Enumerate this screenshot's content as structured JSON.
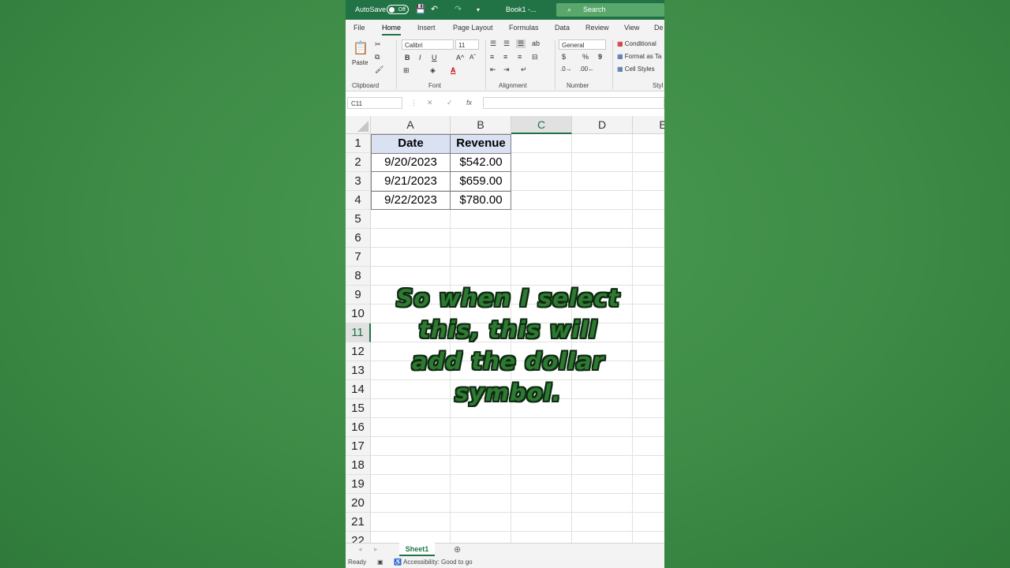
{
  "titlebar": {
    "autosave_label": "AutoSave",
    "autosave_state": "Off",
    "book_title": "Book1 -...",
    "search_placeholder": "Search"
  },
  "ribbon": {
    "tabs": [
      "File",
      "Home",
      "Insert",
      "Page Layout",
      "Formulas",
      "Data",
      "Review",
      "View",
      "De"
    ],
    "active_tab": "Home",
    "clipboard": {
      "paste_label": "Paste",
      "group_label": "Clipboard"
    },
    "font": {
      "font_name": "Calibri",
      "font_size": "11",
      "bold": "B",
      "italic": "I",
      "underline": "U",
      "grow": "A^",
      "shrink": "Aˇ",
      "group_label": "Font"
    },
    "alignment": {
      "group_label": "Alignment"
    },
    "number": {
      "format": "General",
      "currency": "$",
      "percent": "%",
      "comma": "9",
      "group_label": "Number"
    },
    "styles": {
      "conditional": "Conditional",
      "format_as_table": "Format as Ta",
      "cell_styles": "Cell Styles",
      "group_label": "Styl"
    }
  },
  "formula_bar": {
    "name_box": "C11",
    "fx": "fx",
    "value": ""
  },
  "columns": [
    "A",
    "B",
    "C",
    "D",
    "E"
  ],
  "selected_column": "C",
  "rows": [
    "1",
    "2",
    "3",
    "4",
    "5",
    "6",
    "7",
    "8",
    "9",
    "10",
    "11",
    "12",
    "13",
    "14",
    "15",
    "16",
    "17",
    "18",
    "19",
    "20",
    "21",
    "22"
  ],
  "selected_row": "11",
  "table": {
    "headers": [
      "Date",
      "Revenue"
    ],
    "rows": [
      [
        "9/20/2023",
        "$542.00"
      ],
      [
        "9/21/2023",
        "$659.00"
      ],
      [
        "9/22/2023",
        "$780.00"
      ]
    ]
  },
  "sheet_tab": "Sheet1",
  "status": {
    "ready": "Ready",
    "accessibility": "Accessibility: Good to go"
  },
  "caption": [
    "So when I select",
    "this, this will",
    "add the dollar",
    "symbol."
  ],
  "colors": {
    "excel_green": "#217346",
    "background_green": "#3e8e47",
    "header_fill": "#d9e1f2"
  }
}
